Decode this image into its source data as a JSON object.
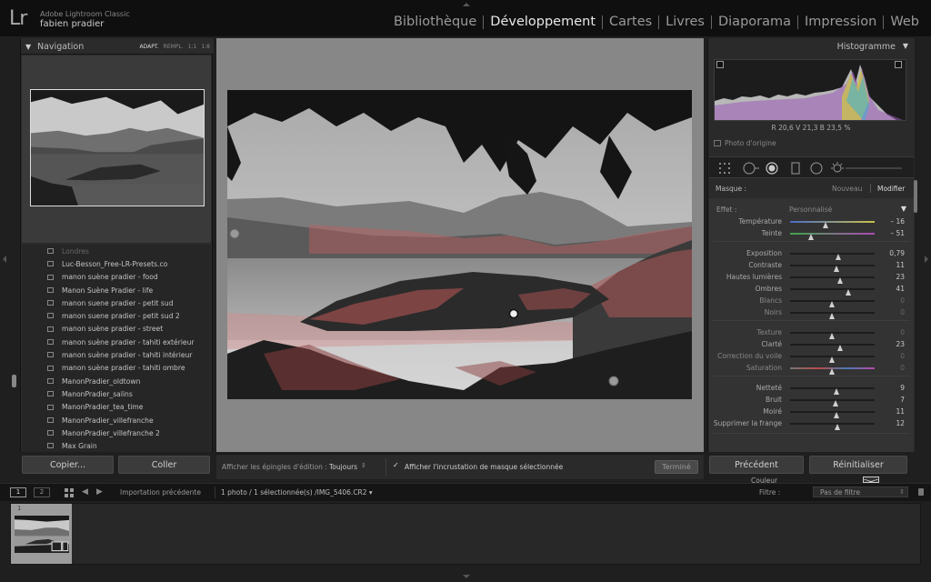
{
  "app": {
    "logo": "Lr",
    "product_name": "Adobe Lightroom Classic",
    "user_name": "fabien pradier"
  },
  "modules": [
    {
      "label": "Bibliothèque",
      "active": false
    },
    {
      "label": "Développement",
      "active": true
    },
    {
      "label": "Cartes",
      "active": false
    },
    {
      "label": "Livres",
      "active": false
    },
    {
      "label": "Diaporama",
      "active": false
    },
    {
      "label": "Impression",
      "active": false
    },
    {
      "label": "Web",
      "active": false
    }
  ],
  "navigator": {
    "title": "Navigation",
    "zoom_options": [
      "ADAPT.",
      "REMPL.",
      "1:1",
      "1:8"
    ],
    "active_zoom": "ADAPT."
  },
  "presets": [
    "Londres",
    "Luc-Besson_Free-LR-Presets.co",
    "manon suène pradier - food",
    "Manon Suène Pradier - life",
    "manon suene pradier - petit sud",
    "manon suene pradier - petit sud 2",
    "manon suène pradier - street",
    "manon suène pradier - tahiti extérieur",
    "manon suène pradier - tahiti intérieur",
    "manon suène pradier - tahiti ombre",
    "ManonPradier_oldtown",
    "ManonPradier_salins",
    "ManonPradier_tea_time",
    "ManonPradier_villefranche",
    "ManonPradier_villefranche 2",
    "Max Grain"
  ],
  "left_buttons": {
    "copy": "Copier...",
    "paste": "Coller"
  },
  "center_toolbar": {
    "pins_label": "Afficher les épingles d'édition :",
    "pins_value": "Toujours",
    "overlay_label": "Afficher l'incrustation de masque sélectionnée",
    "overlay_checked": true,
    "done_label": "Terminé"
  },
  "histogram": {
    "title": "Histogramme",
    "readout": "R  20,6  V  21,3  B  23,5 %",
    "original_label": "Photo d'origine"
  },
  "mask": {
    "label": "Masque :",
    "new_label": "Nouveau",
    "edit_label": "Modifier"
  },
  "effect": {
    "label": "Effet :",
    "value": "Personnalisé"
  },
  "sliders": [
    {
      "label": "Température",
      "value": "– 16",
      "pos": 0.43,
      "kind": "temp",
      "dim": false
    },
    {
      "label": "Teinte",
      "value": "– 51",
      "pos": 0.25,
      "kind": "tint",
      "dim": false
    },
    {
      "label": "Exposition",
      "value": "0,79",
      "pos": 0.58,
      "kind": "plain",
      "dim": false
    },
    {
      "label": "Contraste",
      "value": "11",
      "pos": 0.55,
      "kind": "plain",
      "dim": false
    },
    {
      "label": "Hautes lumières",
      "value": "23",
      "pos": 0.6,
      "kind": "plain",
      "dim": false
    },
    {
      "label": "Ombres",
      "value": "41",
      "pos": 0.69,
      "kind": "plain",
      "dim": false
    },
    {
      "label": "Blancs",
      "value": "0",
      "pos": 0.5,
      "kind": "plain",
      "dim": true
    },
    {
      "label": "Noirs",
      "value": "0",
      "pos": 0.5,
      "kind": "plain",
      "dim": true
    },
    {
      "label": "Texture",
      "value": "0",
      "pos": 0.5,
      "kind": "plain",
      "dim": true
    },
    {
      "label": "Clarté",
      "value": "23",
      "pos": 0.6,
      "kind": "plain",
      "dim": false
    },
    {
      "label": "Correction du voile",
      "value": "0",
      "pos": 0.5,
      "kind": "plain",
      "dim": true
    },
    {
      "label": "Saturation",
      "value": "0",
      "pos": 0.5,
      "kind": "sat",
      "dim": true
    },
    {
      "label": "Netteté",
      "value": "9",
      "pos": 0.55,
      "kind": "plain",
      "dim": false
    },
    {
      "label": "Bruit",
      "value": "7",
      "pos": 0.54,
      "kind": "plain",
      "dim": false
    },
    {
      "label": "Moiré",
      "value": "11",
      "pos": 0.55,
      "kind": "plain",
      "dim": false
    },
    {
      "label": "Supprimer la frange",
      "value": "12",
      "pos": 0.56,
      "kind": "plain",
      "dim": false
    }
  ],
  "color_label": "Couleur",
  "right_buttons": {
    "previous": "Précédent",
    "reset": "Réinitialiser"
  },
  "filmstrip_bar": {
    "screen1": "1",
    "screen2": "2",
    "source": "Importation précédente",
    "selection": "1 photo / 1 sélectionnée(s) /IMG_5406.CR2 ▾",
    "filter_label": "Filtre :",
    "filter_value": "Pas de filtre"
  },
  "filmstrip": {
    "index": "1"
  },
  "colors": {
    "mask_overlay": "#d24a4a",
    "panel_bg": "#2a2a2a",
    "center_bg": "#878787"
  },
  "icons": {
    "grid": "grid-icon",
    "back": "arrow-left-icon",
    "forward": "arrow-right-icon",
    "tools": [
      "crop-overlay-icon",
      "spot-removal-icon",
      "red-eye-icon",
      "graduated-filter-icon",
      "radial-filter-icon",
      "adjustment-brush-icon"
    ]
  }
}
